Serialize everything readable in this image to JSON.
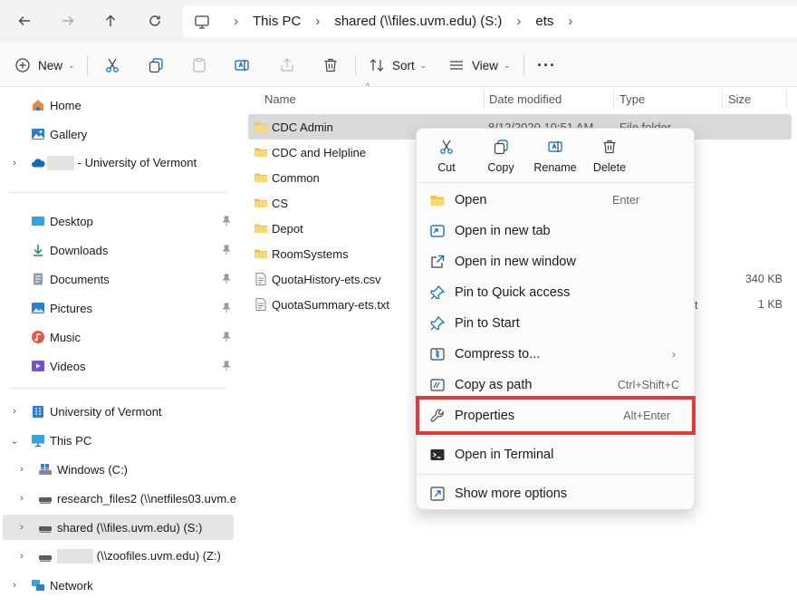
{
  "address": {
    "crumbs": [
      "This PC",
      "shared (\\\\files.uvm.edu) (S:)",
      "ets"
    ]
  },
  "toolbar": {
    "new_label": "New",
    "sort_label": "Sort",
    "view_label": "View",
    "more_label": "···"
  },
  "sidebar": {
    "home": "Home",
    "gallery": "Gallery",
    "onedrive_suffix": "- University of Vermont",
    "desktop": "Desktop",
    "downloads": "Downloads",
    "documents": "Documents",
    "pictures": "Pictures",
    "music": "Music",
    "videos": "Videos",
    "uvm": "University of Vermont",
    "thispc": "This PC",
    "windows": "Windows (C:)",
    "research": "research_files2 (\\\\netfiles03.uvm.e",
    "shared": "shared (\\\\files.uvm.edu) (S:)",
    "zoo_suffix": "(\\\\zoofiles.uvm.edu) (Z:)",
    "network": "Network"
  },
  "columns": {
    "name": "Name",
    "date": "Date modified",
    "type": "Type",
    "size": "Size"
  },
  "files": [
    {
      "name": "CDC Admin",
      "date": "8/12/2020 10:51 AM",
      "type": "File folder",
      "size": ""
    },
    {
      "name": "CDC and Helpline",
      "date": "",
      "type": "",
      "size": ""
    },
    {
      "name": "Common",
      "date": "",
      "type": "",
      "size": ""
    },
    {
      "name": "CS",
      "date": "",
      "type": "",
      "size": ""
    },
    {
      "name": "Depot",
      "date": "",
      "type": "",
      "size": ""
    },
    {
      "name": "RoomSystems",
      "date": "",
      "type": "",
      "size": ""
    },
    {
      "name": "QuotaHistory-ets.csv",
      "date": "",
      "type": "",
      "size": "340 KB"
    },
    {
      "name": "QuotaSummary-ets.txt",
      "date": "",
      "type": "t",
      "size": "1 KB"
    }
  ],
  "context_menu": {
    "quick": {
      "cut": "Cut",
      "copy": "Copy",
      "rename": "Rename",
      "delete": "Delete"
    },
    "open": {
      "label": "Open",
      "shortcut": "Enter"
    },
    "open_tab": "Open in new tab",
    "open_window": "Open in new window",
    "pin_quick": "Pin to Quick access",
    "pin_start": "Pin to Start",
    "compress": "Compress to...",
    "copy_path": {
      "label": "Copy as path",
      "shortcut": "Ctrl+Shift+C"
    },
    "properties": {
      "label": "Properties",
      "shortcut": "Alt+Enter"
    },
    "terminal": "Open in Terminal",
    "more": "Show more options"
  },
  "colors": {
    "highlight": "#e5383b",
    "folder": "#f2c14e",
    "accent": "#0067c0"
  }
}
